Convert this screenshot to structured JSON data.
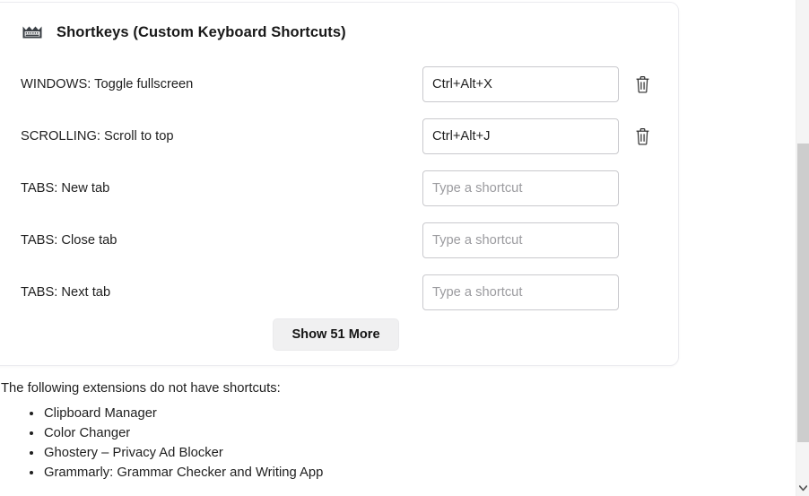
{
  "card": {
    "icon": "keyboard-icon",
    "title": "Shortkeys (Custom Keyboard Shortcuts)",
    "shortcut_rows": [
      {
        "label": "WINDOWS: Toggle fullscreen",
        "value": "Ctrl+Alt+X",
        "placeholder": "Type a shortcut",
        "has_clear": true,
        "clear_icon": "trash-icon"
      },
      {
        "label": "SCROLLING: Scroll to top",
        "value": "Ctrl+Alt+J",
        "placeholder": "Type a shortcut",
        "has_clear": true,
        "clear_icon": "trash-icon"
      },
      {
        "label": "TABS: New tab",
        "value": "",
        "placeholder": "Type a shortcut",
        "has_clear": false,
        "clear_icon": "trash-icon"
      },
      {
        "label": "TABS: Close tab",
        "value": "",
        "placeholder": "Type a shortcut",
        "has_clear": false,
        "clear_icon": "trash-icon"
      },
      {
        "label": "TABS: Next tab",
        "value": "",
        "placeholder": "Type a shortcut",
        "has_clear": false,
        "clear_icon": "trash-icon"
      }
    ],
    "show_more_label": "Show 51 More"
  },
  "below": {
    "heading": "The following extensions do not have shortcuts:",
    "extensions": [
      "Clipboard Manager",
      "Color Changer",
      "Ghostery – Privacy Ad Blocker",
      "Grammarly: Grammar Checker and Writing App"
    ]
  },
  "scrollbar": {
    "down_arrow_icon": "chevron-down-icon"
  },
  "colors": {
    "page_background": "#ffffff",
    "card_border": "#ececf0",
    "input_border": "#c9c9cd",
    "placeholder_text": "#9b9b9f",
    "button_background": "#f0f0f1",
    "text": "#1f1f1f",
    "scrollbar_track": "#f4f4f4",
    "scrollbar_thumb": "#cdcdcd"
  }
}
